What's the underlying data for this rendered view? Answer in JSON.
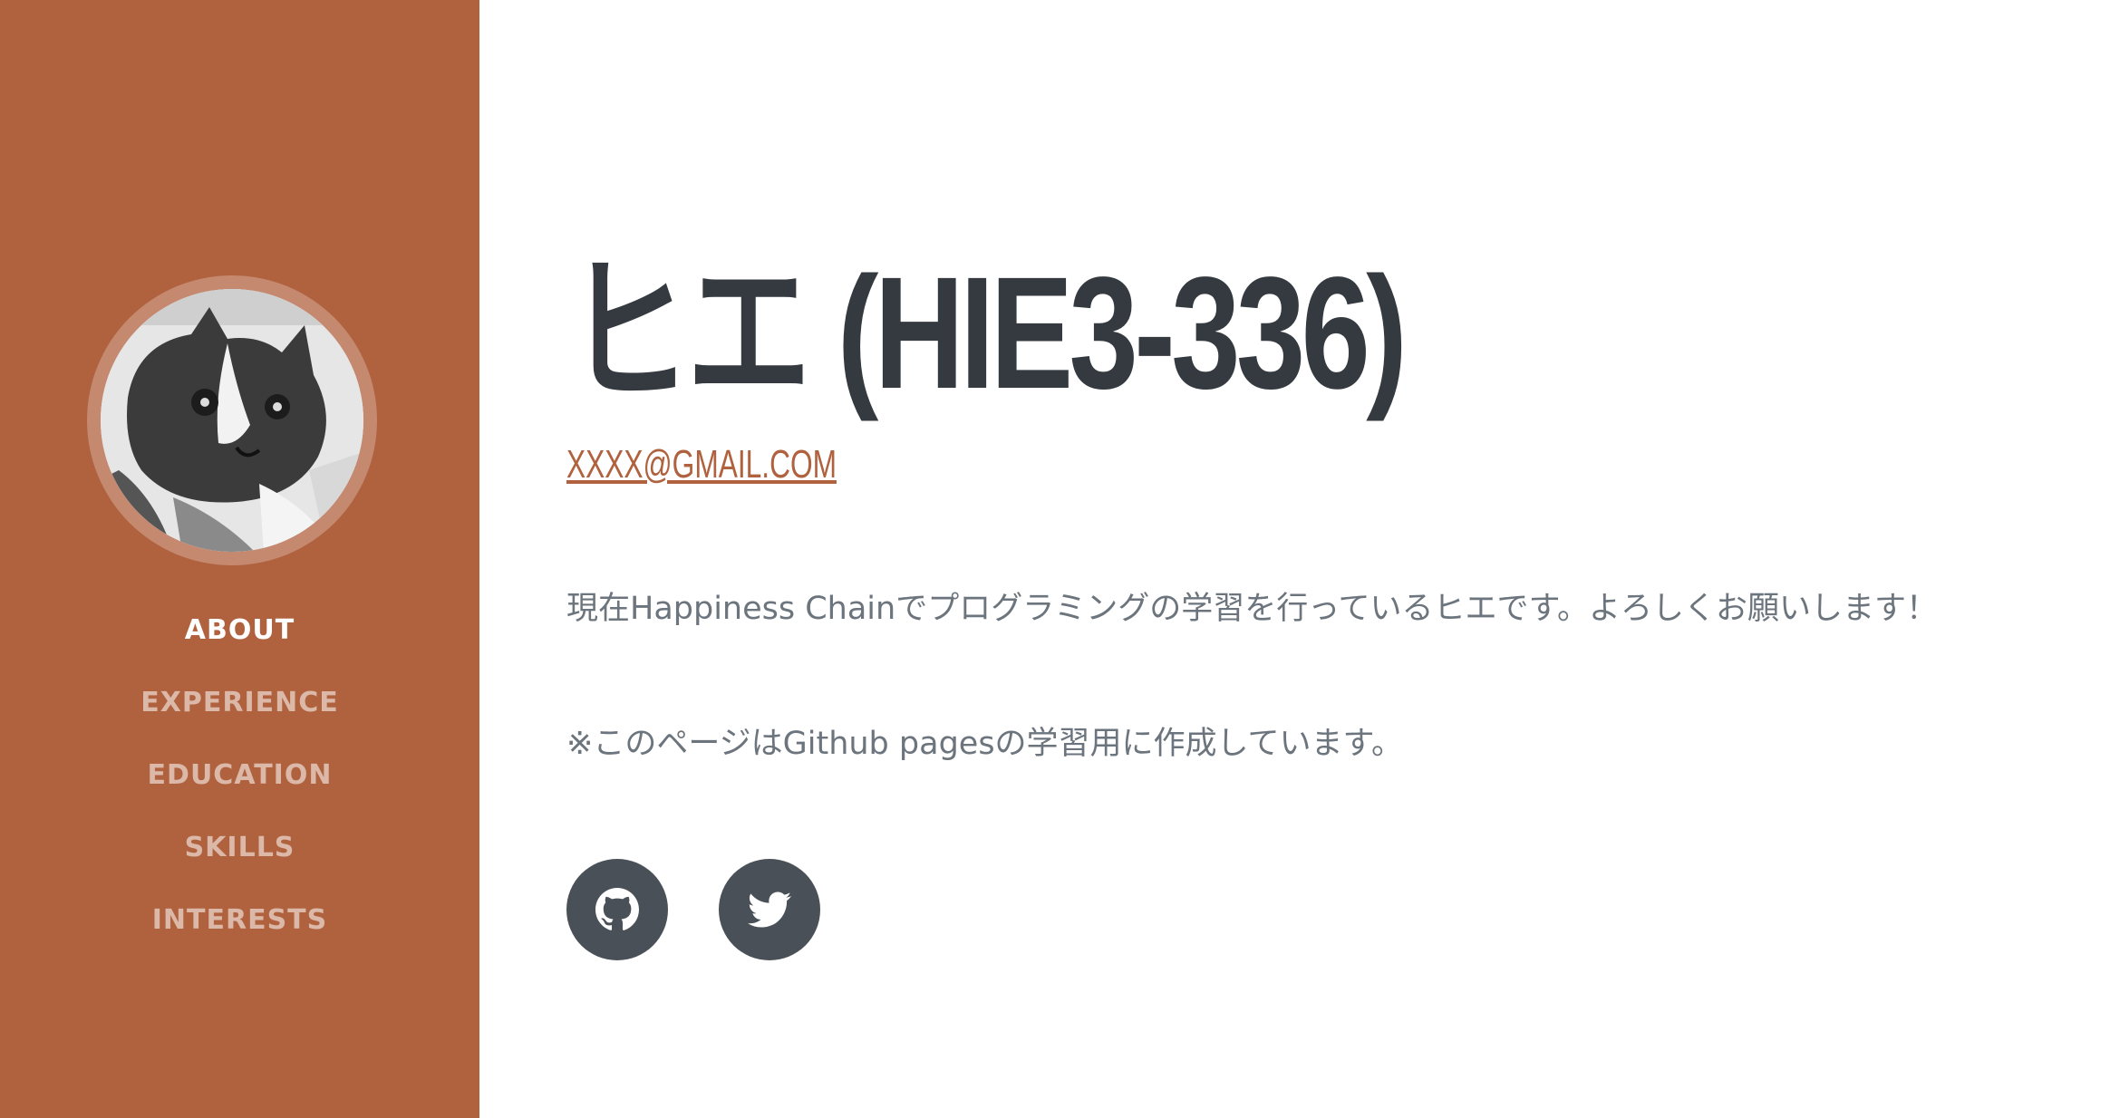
{
  "sidebar": {
    "avatar_icon": "cat-photo",
    "nav": [
      {
        "label": "ABOUT",
        "active": true
      },
      {
        "label": "EXPERIENCE",
        "active": false
      },
      {
        "label": "EDUCATION",
        "active": false
      },
      {
        "label": "SKILLS",
        "active": false
      },
      {
        "label": "INTERESTS",
        "active": false
      }
    ]
  },
  "about": {
    "title": "ヒエ (HIE3-336)",
    "email": "XXXX@GMAIL.COM",
    "intro": "現在Happiness Chainでプログラミングの学習を行っているヒエです。よろしくお願いします！",
    "note": "※このページはGithub pagesの学習用に作成しています。"
  },
  "social": [
    {
      "icon": "github-icon"
    },
    {
      "icon": "twitter-icon"
    }
  ],
  "colors": {
    "sidebar_bg": "#b0623f",
    "title_text": "#343a40",
    "body_text": "#6c757d",
    "social_bg": "#495057"
  }
}
